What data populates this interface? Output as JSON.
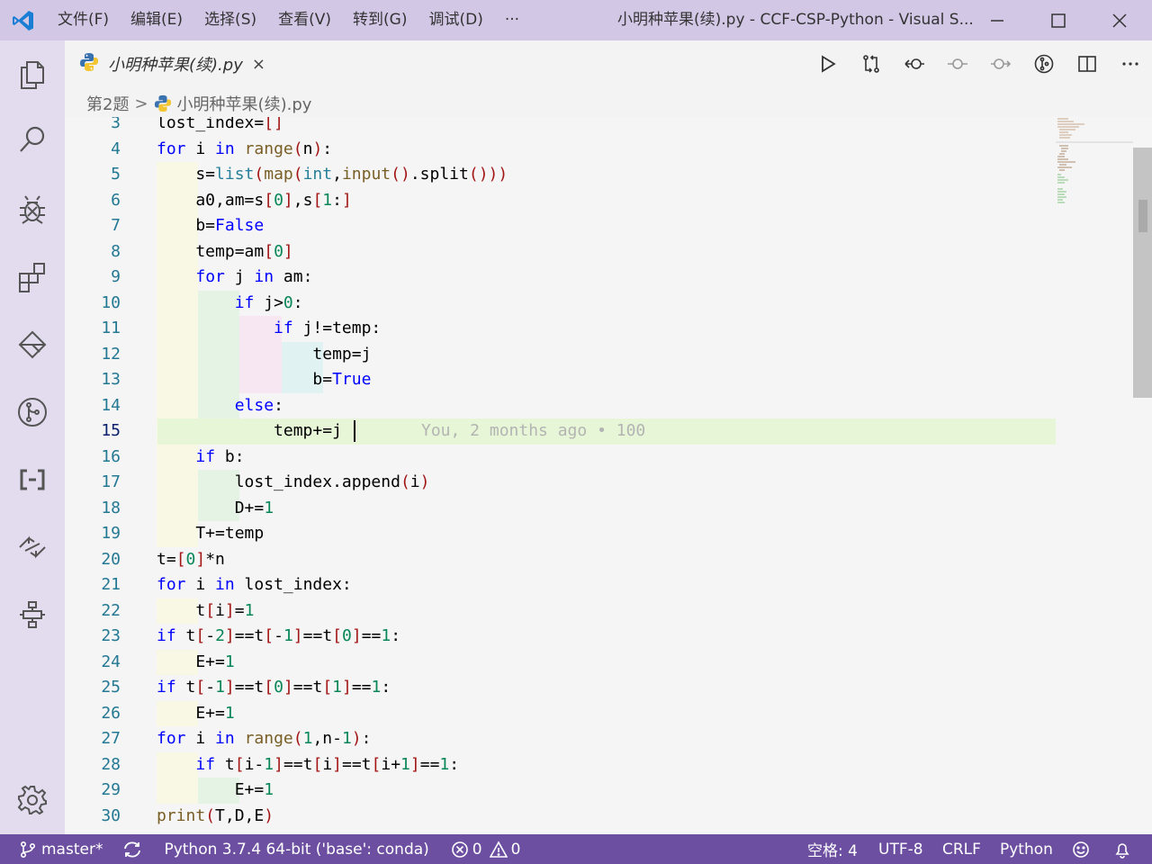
{
  "window": {
    "title": "小明种苹果(续).py - CCF-CSP-Python - Visual S...",
    "menu": [
      "文件(F)",
      "编辑(E)",
      "选择(S)",
      "查看(V)",
      "转到(G)",
      "调试(D)",
      "···"
    ],
    "controls": [
      "minimize",
      "maximize",
      "close"
    ]
  },
  "activitybar": {
    "items": [
      "explorer-icon",
      "search-icon",
      "debug-icon",
      "extensions-icon",
      "remote-explorer-icon",
      "source-control-icon",
      "brackets-icon",
      "live-share-icon",
      "flowchart-icon"
    ],
    "settings": "gear-icon"
  },
  "tab": {
    "label": "小明种苹果(续).py",
    "close": "×"
  },
  "editor_actions": [
    "run-icon",
    "compare-icon",
    "go-back-icon",
    "previous-change-icon",
    "next-change-icon",
    "git-lens-icon",
    "split-editor-icon",
    "more-actions-icon"
  ],
  "breadcrumb": {
    "folder": "第2题",
    "separator": ">",
    "file": "小明种苹果(续).py"
  },
  "editor": {
    "current_line": 15,
    "blame": "You, 2 months ago • 100",
    "lines": [
      {
        "n": "3",
        "text": "lost_index=[]"
      },
      {
        "n": "4",
        "text": "for i in range(n):"
      },
      {
        "n": "5",
        "text": "    s=list(map(int,input().split()))"
      },
      {
        "n": "6",
        "text": "    a0,am=s[0],s[1:]"
      },
      {
        "n": "7",
        "text": "    b=False"
      },
      {
        "n": "8",
        "text": "    temp=am[0]"
      },
      {
        "n": "9",
        "text": "    for j in am:"
      },
      {
        "n": "10",
        "text": "        if j>0:"
      },
      {
        "n": "11",
        "text": "            if j!=temp:"
      },
      {
        "n": "12",
        "text": "                temp=j"
      },
      {
        "n": "13",
        "text": "                b=True"
      },
      {
        "n": "14",
        "text": "        else:"
      },
      {
        "n": "15",
        "text": "            temp+=j"
      },
      {
        "n": "16",
        "text": "    if b:"
      },
      {
        "n": "17",
        "text": "        lost_index.append(i)"
      },
      {
        "n": "18",
        "text": "        D+=1"
      },
      {
        "n": "19",
        "text": "    T+=temp"
      },
      {
        "n": "20",
        "text": "t=[0]*n"
      },
      {
        "n": "21",
        "text": "for i in lost_index:"
      },
      {
        "n": "22",
        "text": "    t[i]=1"
      },
      {
        "n": "23",
        "text": "if t[-2]==t[-1]==t[0]==1:"
      },
      {
        "n": "24",
        "text": "    E+=1"
      },
      {
        "n": "25",
        "text": "if t[-1]==t[0]==t[1]==1:"
      },
      {
        "n": "26",
        "text": "    E+=1"
      },
      {
        "n": "27",
        "text": "for i in range(1,n-1):"
      },
      {
        "n": "28",
        "text": "    if t[i-1]==t[i]==t[i+1]==1:"
      },
      {
        "n": "29",
        "text": "        E+=1"
      },
      {
        "n": "30",
        "text": "print(T,D,E)"
      }
    ]
  },
  "statusbar": {
    "branch": "master*",
    "interpreter": "Python 3.7.4 64-bit ('base': conda)",
    "errors": "0",
    "warnings": "0",
    "indent": "空格: 4",
    "encoding": "UTF-8",
    "eol": "CRLF",
    "language": "Python"
  },
  "colors": {
    "titlebar": "#d3c7e6",
    "activitybar": "#e2dcee",
    "statusbar": "#6c4fa0",
    "current_line": "#e6f6d6"
  }
}
